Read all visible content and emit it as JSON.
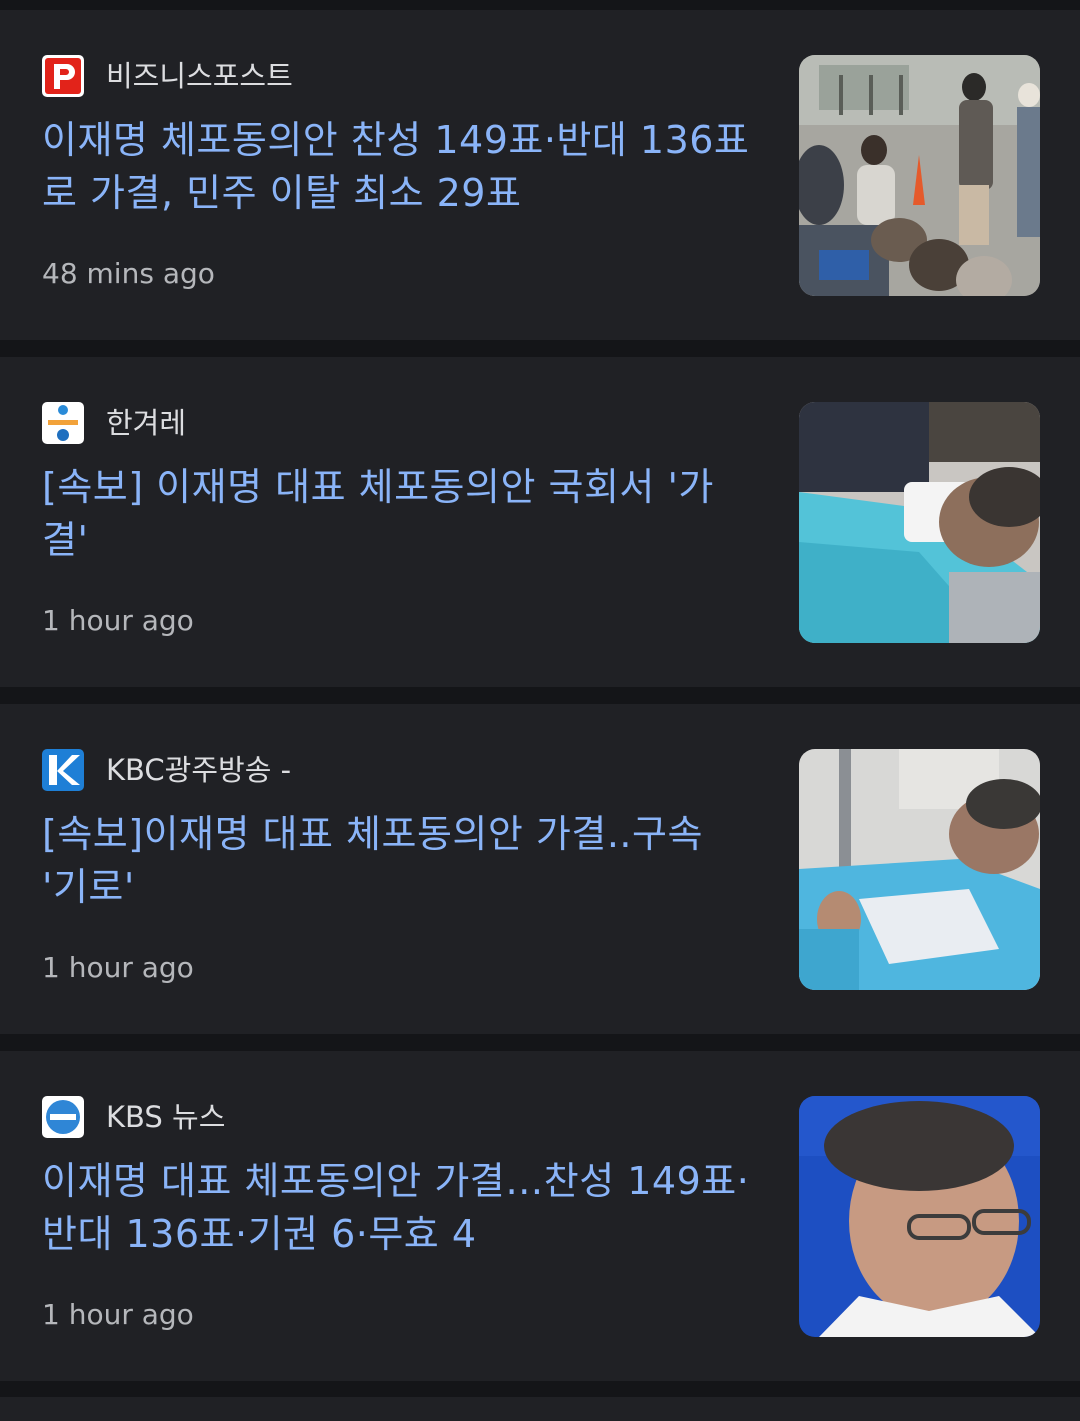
{
  "articles": [
    {
      "source": "비즈니스포스트",
      "logo": "businesspost-logo-icon",
      "headline": "이재명 체포동의안 찬성 149표·반대 136표로 가결, 민주 이탈 최소 29표",
      "time": "48 mins ago",
      "thumbnail": "crowd-protest-photo"
    },
    {
      "source": "한겨레",
      "logo": "hankyoreh-logo-icon",
      "headline": "[속보] 이재명 대표 체포동의안 국회서 '가결'",
      "time": "1 hour ago",
      "thumbnail": "hospital-bed-photo"
    },
    {
      "source": "KBC광주방송 -",
      "logo": "kbc-logo-icon",
      "headline": "[속보]이재명 대표 체포동의안 가결..구속 '기로'",
      "time": "1 hour ago",
      "thumbnail": "hospital-patient-photo"
    },
    {
      "source": "KBS 뉴스",
      "logo": "kbs-logo-icon",
      "headline": "이재명 대표 체포동의안 가결…찬성 149표·반대 136표·기권 6·무효 4",
      "time": "1 hour ago",
      "thumbnail": "portrait-photo"
    }
  ],
  "colors": {
    "background": "#141518",
    "card": "#202125",
    "headline": "#8ab4f8",
    "source_text": "#dcdde0",
    "time_text": "#b5b7bb"
  }
}
